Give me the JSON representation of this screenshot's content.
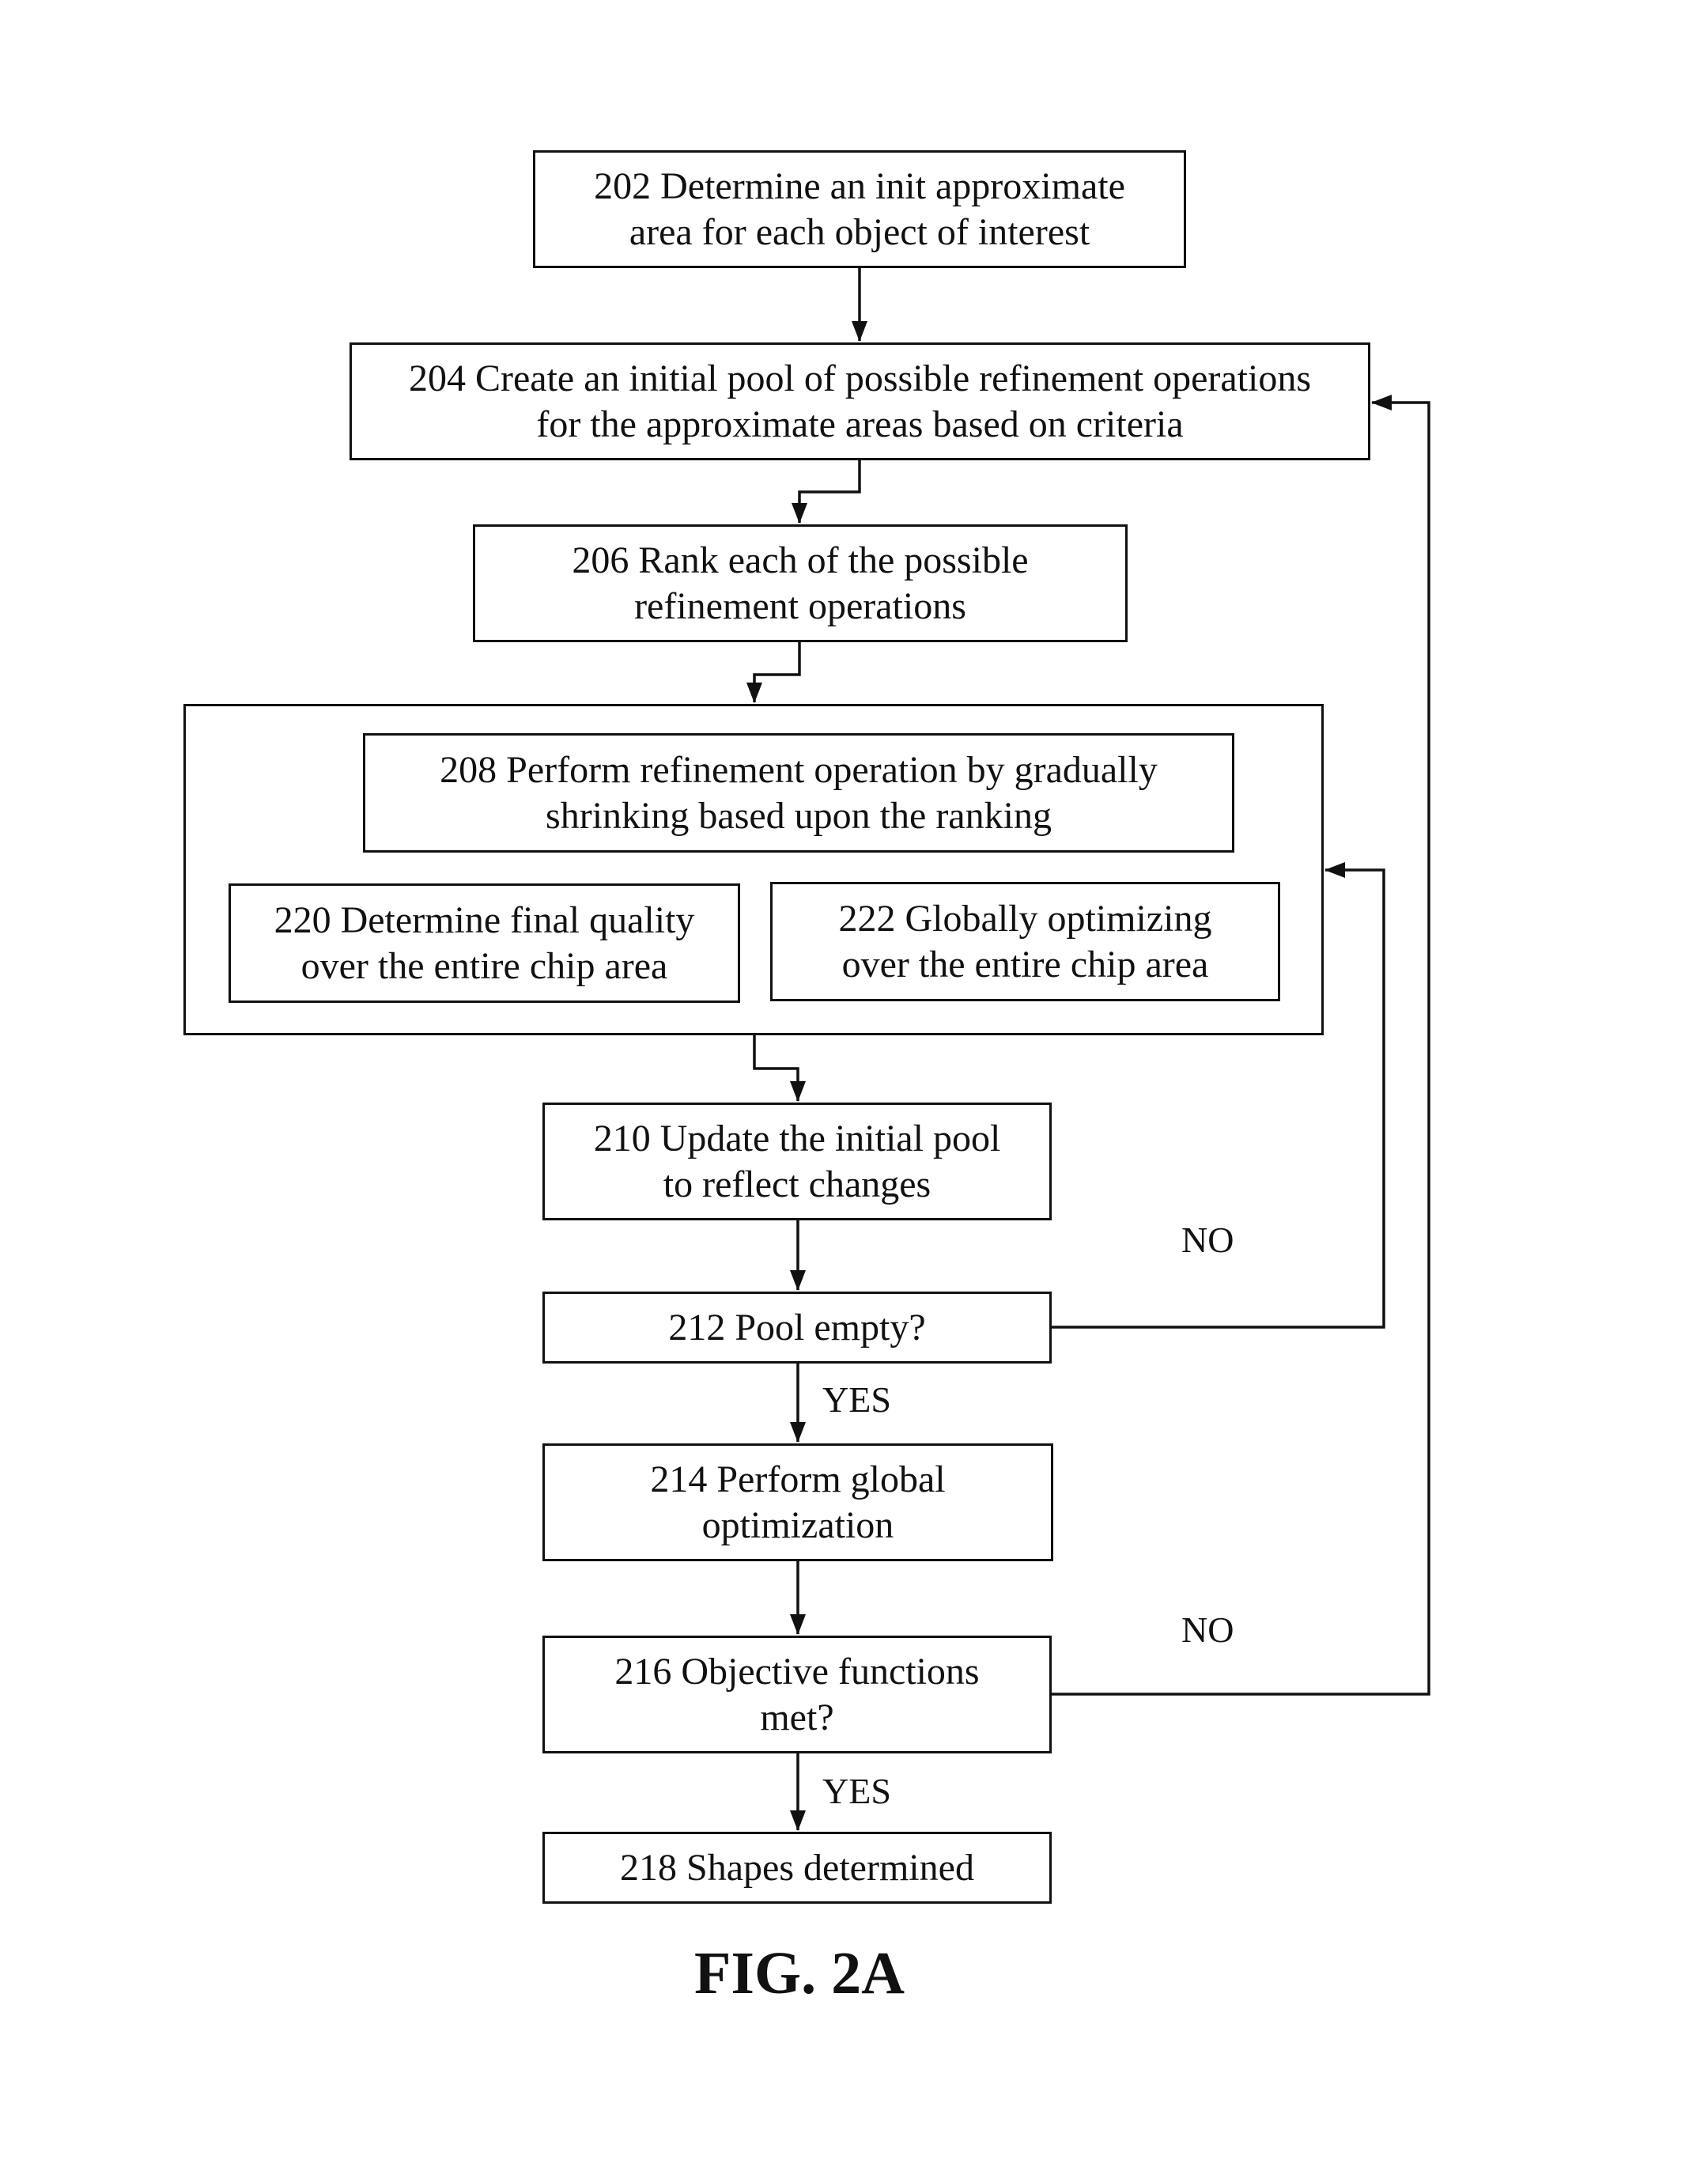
{
  "figure": {
    "caption": "FIG. 2A",
    "steps": [
      {
        "id": "202",
        "text": "202  Determine an init approximate\narea for each object of interest"
      },
      {
        "id": "204",
        "text": "204  Create an initial pool of possible refinement operations\nfor the approximate areas based on criteria"
      },
      {
        "id": "206",
        "text": "206  Rank each of the possible\nrefinement operations"
      },
      {
        "id": "208",
        "text": "208  Perform refinement operation by gradually\nshrinking based upon the ranking"
      },
      {
        "id": "220",
        "text": "220  Determine final quality\nover the entire chip area"
      },
      {
        "id": "222",
        "text": "222  Globally optimizing\nover the entire chip area"
      },
      {
        "id": "210",
        "text": "210  Update the initial pool\nto reflect changes"
      },
      {
        "id": "212",
        "text": "212  Pool empty?"
      },
      {
        "id": "214",
        "text": "214  Perform global\noptimization"
      },
      {
        "id": "216",
        "text": "216  Objective functions\nmet?"
      },
      {
        "id": "218",
        "text": "218  Shapes determined"
      }
    ],
    "labels": {
      "pool_empty_no": "NO",
      "pool_empty_yes": "YES",
      "objective_no": "NO",
      "objective_yes": "YES"
    },
    "edges": [
      {
        "from": "202",
        "to": "204"
      },
      {
        "from": "204",
        "to": "206"
      },
      {
        "from": "206",
        "to": "208-group"
      },
      {
        "from": "208-group",
        "to": "210"
      },
      {
        "from": "210",
        "to": "212"
      },
      {
        "from": "212",
        "to": "214",
        "label": "YES"
      },
      {
        "from": "212",
        "to": "208-group",
        "label": "NO"
      },
      {
        "from": "214",
        "to": "216"
      },
      {
        "from": "216",
        "to": "218",
        "label": "YES"
      },
      {
        "from": "216",
        "to": "204",
        "label": "NO"
      }
    ]
  }
}
